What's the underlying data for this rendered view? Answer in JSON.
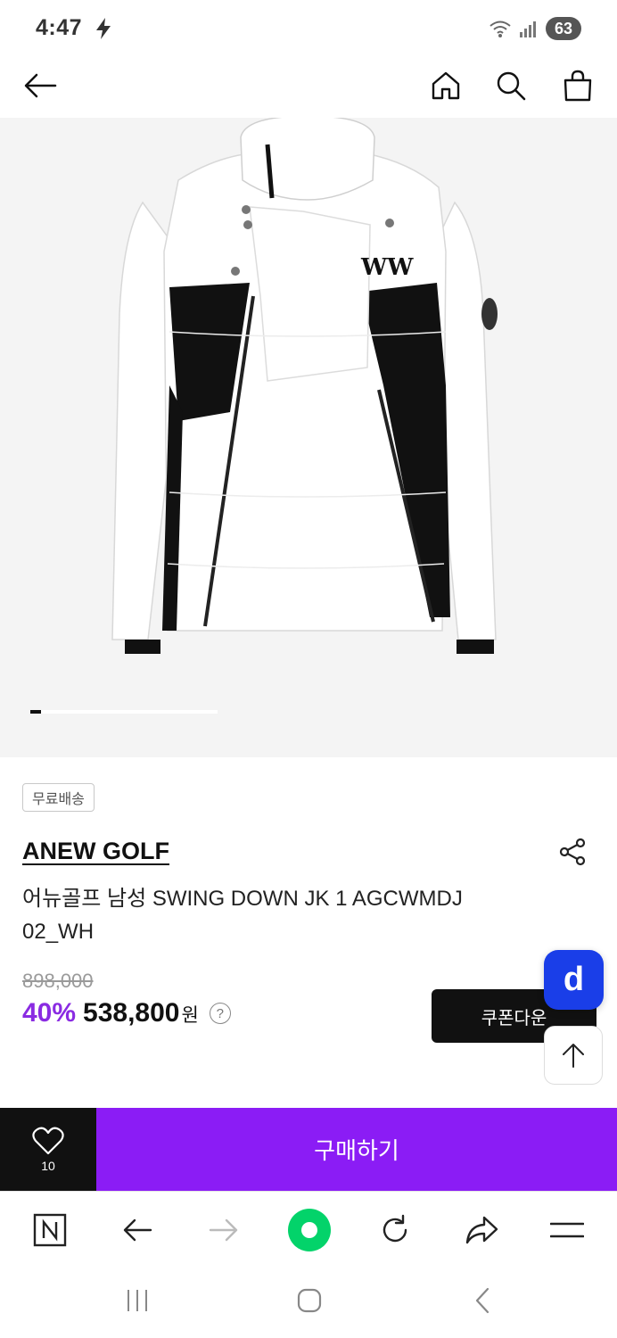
{
  "status_bar": {
    "time": "4:47",
    "battery": "63",
    "icons": [
      "charging-bolt-icon",
      "wifi-icon",
      "signal-icon",
      "battery-icon"
    ]
  },
  "top_nav": {
    "icons": [
      "back-arrow-icon",
      "home-icon",
      "search-icon",
      "shopping-bag-icon"
    ]
  },
  "hero": {
    "carousel_index": 1,
    "carousel_progress": 0.057
  },
  "product": {
    "badge": "무료배송",
    "brand": "ANEW GOLF",
    "name": "어뉴골프 남성 SWING DOWN JK 1 AGCWMDJ 02_WH",
    "original_price": "898,000",
    "discount": "40%",
    "price": "538,800",
    "currency": "원",
    "help": "?",
    "coupon_label": "쿠폰다운",
    "d_button": "d"
  },
  "buy_bar": {
    "wish_count": "10",
    "buy_label": "구매하기"
  },
  "browser_bar": {
    "icons": [
      "naver-n-icon",
      "back-icon",
      "forward-icon",
      "home-circle-icon",
      "refresh-icon",
      "share-icon",
      "menu-icon"
    ]
  },
  "system_nav": {
    "icons": [
      "recent-apps-icon",
      "home-icon",
      "back-icon"
    ]
  },
  "colors": {
    "accent_purple": "#8b1cf5",
    "discount_purple": "#8a2be2",
    "d_blue": "#1a3ee8",
    "naver_green": "#03d36a"
  }
}
